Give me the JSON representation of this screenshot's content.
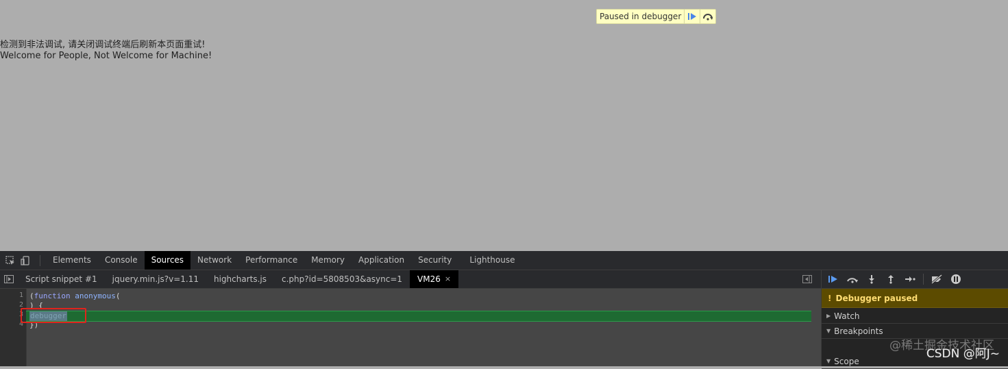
{
  "page": {
    "line1": "检测到非法调试, 请关闭调试终端后刷新本页面重试!",
    "line2": "Welcome for People, Not Welcome for Machine!",
    "overlay": {
      "message": "Paused in debugger",
      "resume_icon": "resume-icon",
      "step_over_icon": "step-over-icon"
    }
  },
  "devtools": {
    "main_tabs": [
      "Elements",
      "Console",
      "Sources",
      "Network",
      "Performance",
      "Memory",
      "Application",
      "Security",
      "Lighthouse"
    ],
    "active_main_tab": "Sources",
    "file_tabs": [
      "Script snippet #1",
      "jquery.min.js?v=1.11",
      "highcharts.js",
      "c.php?id=5808503&async=1",
      "VM26"
    ],
    "active_file_tab": "VM26",
    "close_glyph": "×",
    "editor": {
      "line_numbers": [
        "1",
        "2",
        "3",
        "4"
      ],
      "code": {
        "l1_open": "(",
        "l1_kw": "function",
        "l1_space": " ",
        "l1_fn": "anonymous",
        "l1_close": "(",
        "l2": ") {",
        "l3": "debugger",
        "l4": "})"
      },
      "paused_line": 3
    },
    "sidebar": {
      "paused_banner": "Debugger paused",
      "warn_glyph": "!",
      "sections": [
        "Watch",
        "Breakpoints",
        "Scope"
      ]
    }
  },
  "watermark": {
    "top": "@稀土掘金技术社区",
    "bottom": "CSDN @阿J~"
  },
  "colors": {
    "page_bg": "#adadad",
    "devtools_bg": "#242424",
    "exec_line": "#1e6a32",
    "paused_banner": "#5c4b00",
    "highlight_box": "#e0241c",
    "overlay_bg": "#ffffc2"
  }
}
